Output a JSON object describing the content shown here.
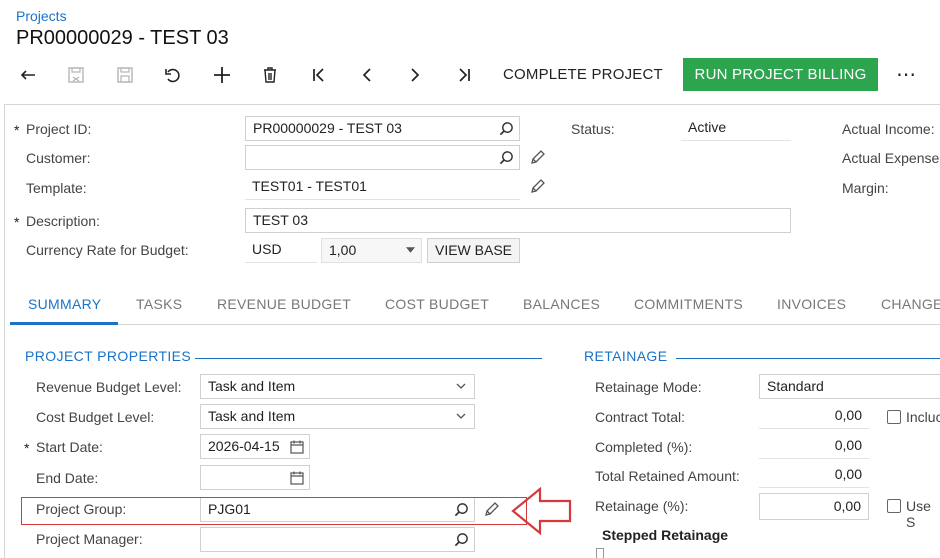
{
  "breadcrumb": "Projects",
  "page_title": "PR00000029 - TEST 03",
  "toolbar": {
    "complete_project": "COMPLETE PROJECT",
    "run_billing": "RUN PROJECT BILLING",
    "more": "⋯",
    "icons": [
      "back-arrow-icon",
      "save-close-icon",
      "save-icon",
      "undo-icon",
      "add-icon",
      "delete-icon",
      "first-record-icon",
      "previous-record-icon",
      "next-record-icon",
      "last-record-icon"
    ]
  },
  "header": {
    "project_id_label": "Project ID:",
    "project_id_value": "PR00000029 - TEST 03",
    "customer_label": "Customer:",
    "customer_value": "",
    "template_label": "Template:",
    "template_value": "TEST01 - TEST01",
    "description_label": "Description:",
    "description_value": "TEST 03",
    "currency_rate_label": "Currency Rate for Budget:",
    "currency_value": "USD",
    "rate_value": "1,00",
    "view_base": "VIEW BASE",
    "status_label": "Status:",
    "status_value": "Active",
    "actual_income_label": "Actual Income:",
    "actual_expense_label": "Actual Expense",
    "margin_label": "Margin:",
    "required_mark": "*"
  },
  "tabs": [
    "SUMMARY",
    "TASKS",
    "REVENUE BUDGET",
    "COST BUDGET",
    "BALANCES",
    "COMMITMENTS",
    "INVOICES",
    "CHANGE"
  ],
  "project_properties": {
    "title": "PROJECT PROPERTIES",
    "revenue_budget_level_label": "Revenue Budget Level:",
    "revenue_budget_level_value": "Task and Item",
    "cost_budget_level_label": "Cost Budget Level:",
    "cost_budget_level_value": "Task and Item",
    "start_date_label": "Start Date:",
    "start_date_value": "2026-04-15",
    "end_date_label": "End Date:",
    "end_date_value": "",
    "project_group_label": "Project Group:",
    "project_group_value": "PJG01",
    "project_manager_label": "Project Manager:",
    "project_manager_value": ""
  },
  "retainage": {
    "title": "RETAINAGE",
    "mode_label": "Retainage Mode:",
    "mode_value": "Standard",
    "contract_total_label": "Contract Total:",
    "contract_total_value": "0,00",
    "include_label": "Incluc",
    "completed_label": "Completed (%):",
    "completed_value": "0,00",
    "total_retained_label": "Total Retained Amount:",
    "total_retained_value": "0,00",
    "retainage_pct_label": "Retainage (%):",
    "retainage_pct_value": "0,00",
    "use_label": "Use S",
    "stepped_label": "Stepped Retainage"
  },
  "colors": {
    "accent": "#1a73c8",
    "green": "#2da44e",
    "highlight": "#d43a3a"
  }
}
